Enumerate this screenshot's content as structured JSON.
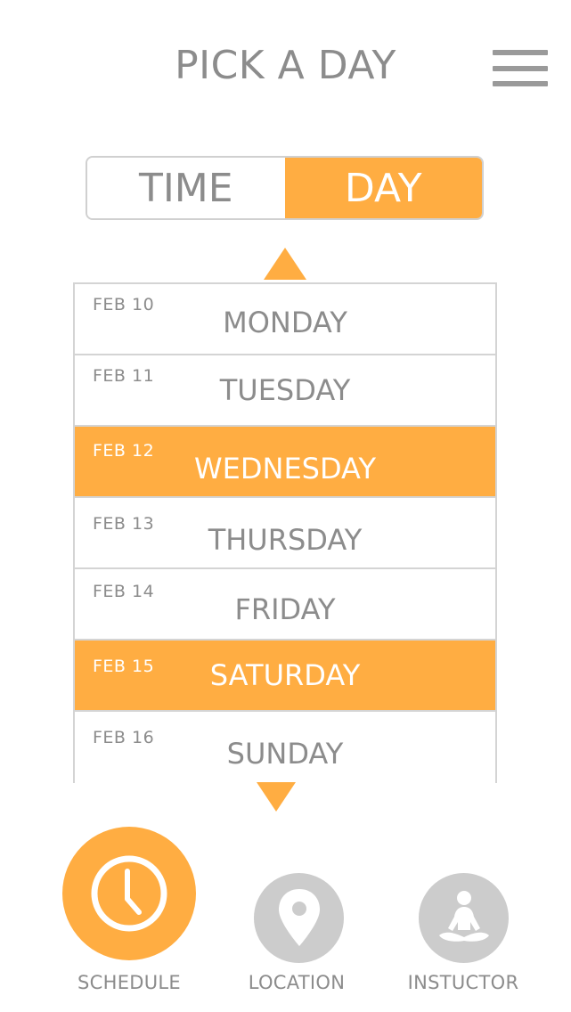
{
  "header": {
    "title": "PICK A DAY",
    "menu_icon": "hamburger-menu-icon"
  },
  "toggle": {
    "options": [
      {
        "label": "TIME",
        "active": false
      },
      {
        "label": "DAY",
        "active": true
      }
    ]
  },
  "day_picker": {
    "up_icon": "triangle-up-icon",
    "down_icon": "triangle-down-icon",
    "days": [
      {
        "date": "FEB 10",
        "day": "MONDAY",
        "selected": false
      },
      {
        "date": "FEB 11",
        "day": "TUESDAY",
        "selected": false
      },
      {
        "date": "FEB 12",
        "day": "WEDNESDAY",
        "selected": true
      },
      {
        "date": "FEB 13",
        "day": "THURSDAY",
        "selected": false
      },
      {
        "date": "FEB 14",
        "day": "FRIDAY",
        "selected": false
      },
      {
        "date": "FEB 15",
        "day": "SATURDAY",
        "selected": true
      },
      {
        "date": "FEB 16",
        "day": "SUNDAY",
        "selected": false
      }
    ]
  },
  "bottom_nav": {
    "items": [
      {
        "label": "SCHEDULE",
        "icon": "clock-icon",
        "active": true
      },
      {
        "label": "LOCATION",
        "icon": "map-pin-icon",
        "active": false
      },
      {
        "label": "INSTUCTOR",
        "icon": "meditation-person-icon",
        "active": false
      }
    ]
  },
  "colors": {
    "accent": "#ffad42",
    "text_gray": "#8c8c8c",
    "inactive_icon_bg": "#cccccc",
    "border": "#d4d4d4"
  }
}
